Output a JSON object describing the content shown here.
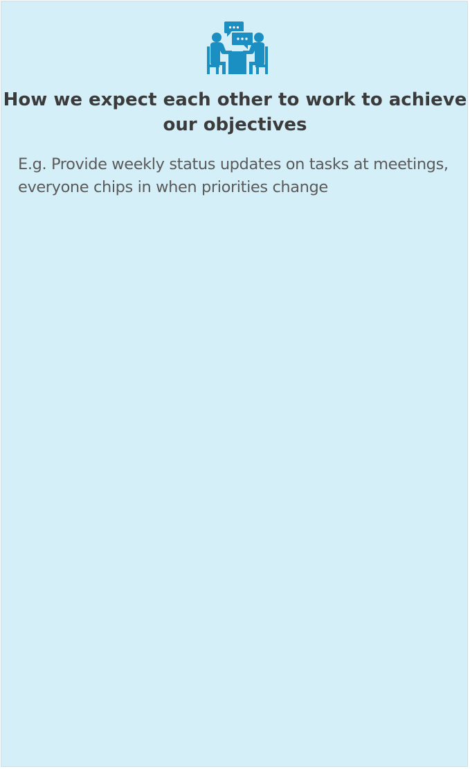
{
  "card": {
    "icon": "meeting-people-icon",
    "title": "How we expect each other to work to achieve our objectives",
    "body": "E.g. Provide weekly status updates on tasks at meetings, everyone chips in when priorities change"
  },
  "colors": {
    "background": "#d5eff9",
    "icon": "#1b8ec2",
    "title": "#3b3b3b",
    "body": "#5a5a5a"
  }
}
